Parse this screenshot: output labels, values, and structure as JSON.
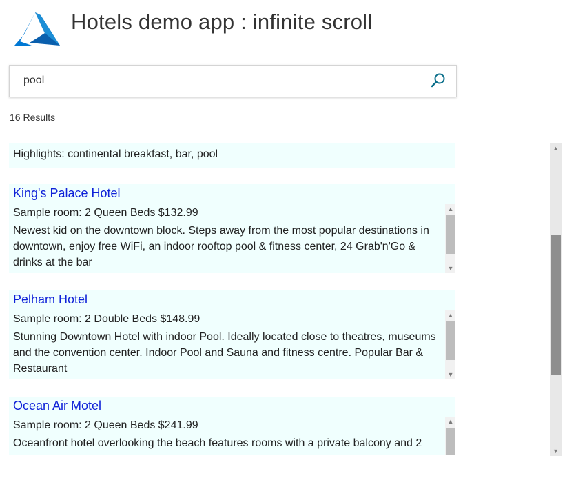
{
  "app": {
    "title": "Hotels demo app : infinite scroll",
    "logo_icon": "azure-logo-icon",
    "logo_color": "#0078d4"
  },
  "search": {
    "value": "pool",
    "icon": "search-icon",
    "icon_color": "#0a6e8a"
  },
  "results": {
    "count_label": "16 Results",
    "partial_highlights": "Highlights: continental breakfast, bar, pool",
    "cards": [
      {
        "name": "King's Palace Hotel",
        "room": "Sample room: 2 Queen Beds $132.99",
        "description": "Newest kid on the downtown block.  Steps away from the most popular destinations in downtown, enjoy free WiFi, an indoor rooftop pool & fitness center, 24 Grab'n'Go & drinks at the bar"
      },
      {
        "name": "Pelham Hotel",
        "room": "Sample room: 2 Double Beds $148.99",
        "description": "Stunning Downtown Hotel with indoor Pool.  Ideally located close to theatres, museums and the convention center. Indoor Pool and Sauna and fitness centre.  Popular Bar & Restaurant"
      },
      {
        "name": "Ocean Air Motel",
        "room": "Sample room: 2 Queen Beds $241.99",
        "description": "Oceanfront hotel overlooking the beach features rooms with a private balcony and 2"
      }
    ]
  },
  "colors": {
    "card_background": "#f0fffe",
    "link": "#0f22d8"
  }
}
